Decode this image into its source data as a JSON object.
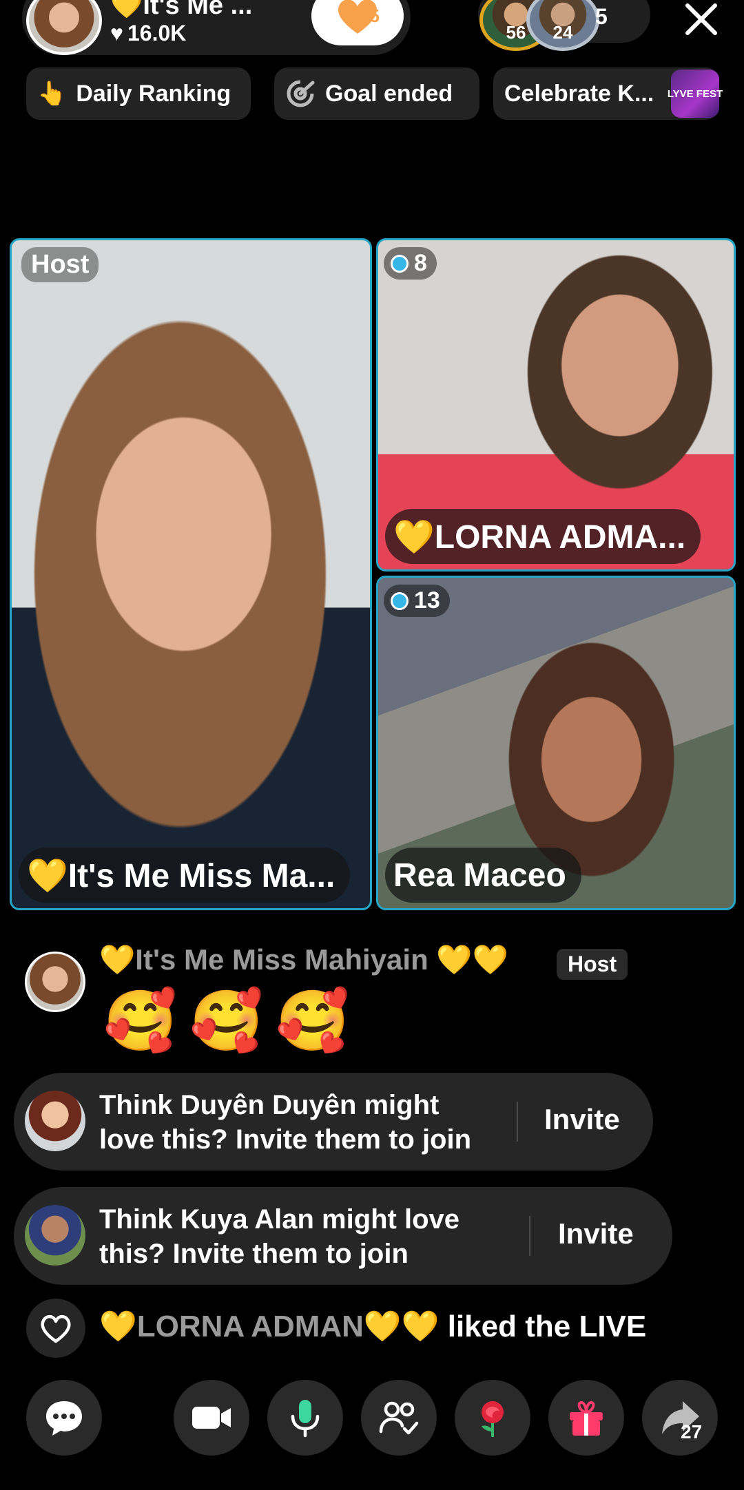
{
  "header": {
    "host_name": "💛It's Me ...",
    "likes": "16.0K",
    "follow_count": "15",
    "viewer_badges": [
      "56",
      "24"
    ],
    "viewer_count": "5"
  },
  "chips": {
    "daily_ranking": "Daily Ranking",
    "goal": "Goal ended",
    "celebrate": "Celebrate K...",
    "fest_badge": "LYVE FEST"
  },
  "tiles": {
    "host": {
      "tag": "Host",
      "name": "💛It's Me Miss Ma..."
    },
    "guest1": {
      "rank": "8",
      "name": "💛LORNA ADMA..."
    },
    "guest2": {
      "rank": "13",
      "name": "Rea Maceo"
    }
  },
  "chat": {
    "sender": "💛It's Me Miss Mahiyain 💛💛",
    "badge": "Host",
    "message": "🥰🥰🥰",
    "invites": [
      {
        "text_line1": "Think Duyên Duyên might",
        "text_line2": "love this? Invite them to join",
        "button": "Invite"
      },
      {
        "text_line1": "Think Kuya Alan might love",
        "text_line2": "this? Invite them to join",
        "button": "Invite"
      }
    ],
    "liked": {
      "name": "💛LORNA ADMAN💛💛",
      "action": " liked the LIVE"
    }
  },
  "toolbar": {
    "share_count": "27"
  },
  "colors": {
    "tile_border": "#25a6c7",
    "gift_pink": "#ff3b6b",
    "mic_green": "#3cd6a0",
    "like_orange": "#f7a24a"
  }
}
